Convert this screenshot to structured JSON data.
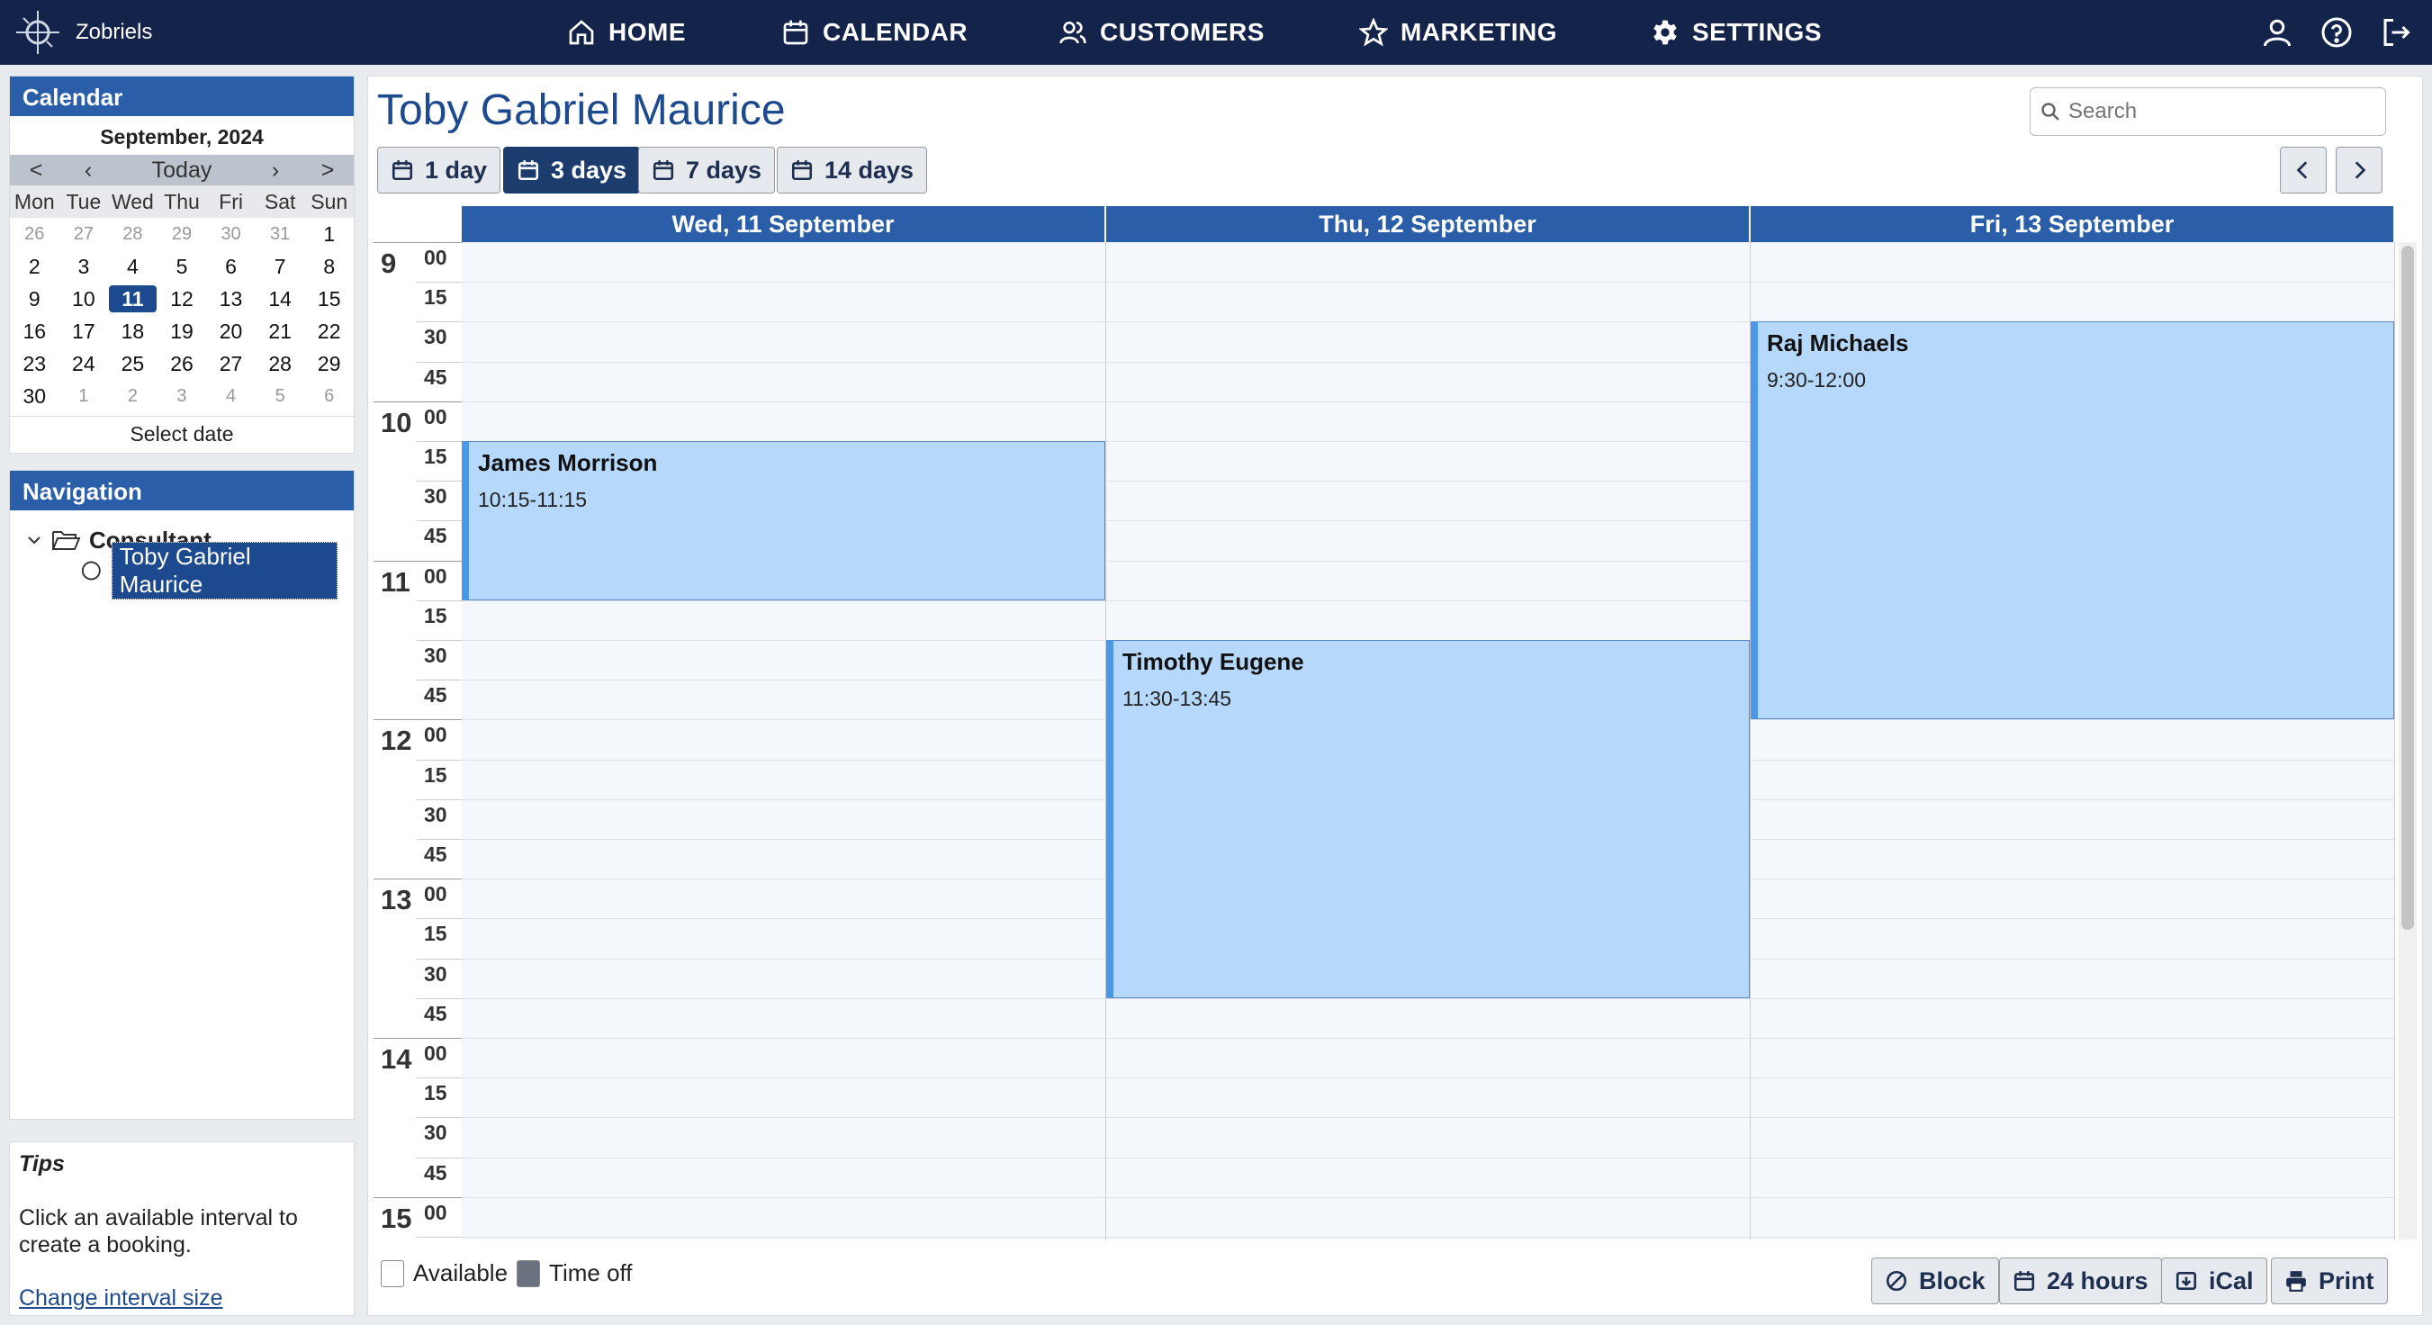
{
  "app": {
    "name": "Zobriels"
  },
  "nav": {
    "home": "HOME",
    "calendar": "CALENDAR",
    "customers": "CUSTOMERS",
    "marketing": "MARKETING",
    "settings": "SETTINGS"
  },
  "colors": {
    "topbar": "#14234a",
    "accent": "#2a5ea8",
    "booking": "#b6d8fb",
    "selected": "#1d4a8f"
  },
  "mini_calendar": {
    "title": "Calendar",
    "month": "September, 2024",
    "today_label": "Today",
    "prev_month": "<",
    "prev": "‹",
    "next": "›",
    "next_month": ">",
    "weekdays": [
      "Mon",
      "Tue",
      "Wed",
      "Thu",
      "Fri",
      "Sat",
      "Sun"
    ],
    "weeks": [
      [
        [
          "26",
          true
        ],
        [
          "27",
          true
        ],
        [
          "28",
          true
        ],
        [
          "29",
          true
        ],
        [
          "30",
          true
        ],
        [
          "31",
          true
        ],
        [
          "1",
          false
        ]
      ],
      [
        [
          "2",
          false
        ],
        [
          "3",
          false
        ],
        [
          "4",
          false
        ],
        [
          "5",
          false
        ],
        [
          "6",
          false
        ],
        [
          "7",
          false
        ],
        [
          "8",
          false
        ]
      ],
      [
        [
          "9",
          false
        ],
        [
          "10",
          false
        ],
        [
          "11",
          false
        ],
        [
          "12",
          false
        ],
        [
          "13",
          false
        ],
        [
          "14",
          false
        ],
        [
          "15",
          false
        ]
      ],
      [
        [
          "16",
          false
        ],
        [
          "17",
          false
        ],
        [
          "18",
          false
        ],
        [
          "19",
          false
        ],
        [
          "20",
          false
        ],
        [
          "21",
          false
        ],
        [
          "22",
          false
        ]
      ],
      [
        [
          "23",
          false
        ],
        [
          "24",
          false
        ],
        [
          "25",
          false
        ],
        [
          "26",
          false
        ],
        [
          "27",
          false
        ],
        [
          "28",
          false
        ],
        [
          "29",
          false
        ]
      ],
      [
        [
          "30",
          false
        ],
        [
          "1",
          true
        ],
        [
          "2",
          true
        ],
        [
          "3",
          true
        ],
        [
          "4",
          true
        ],
        [
          "5",
          true
        ],
        [
          "6",
          true
        ]
      ]
    ],
    "selected_day": "11",
    "select_date": "Select date"
  },
  "navigation": {
    "title": "Navigation",
    "group": "Consultant",
    "selected_person": "Toby Gabriel Maurice"
  },
  "tips": {
    "title": "Tips",
    "text": "Click an available interval to create a booking.",
    "link": "Change interval size"
  },
  "main": {
    "title": "Toby Gabriel Maurice",
    "search_placeholder": "Search",
    "views": [
      "1 day",
      "3 days",
      "7 days",
      "14 days"
    ],
    "active_view": "3 days",
    "days": [
      "Wed, 11 September",
      "Thu, 12 September",
      "Fri, 13 September"
    ],
    "time_labels": {
      "hours": [
        "9",
        "10",
        "11",
        "12",
        "13",
        "14",
        "15"
      ],
      "minutes": [
        "00",
        "15",
        "30",
        "45"
      ]
    },
    "bookings": [
      {
        "name": "James Morrison",
        "time": "10:15-11:15",
        "day": 0,
        "start": 10.25,
        "end": 11.25
      },
      {
        "name": "Timothy Eugene",
        "time": "11:30-13:45",
        "day": 1,
        "start": 11.5,
        "end": 13.75
      },
      {
        "name": "Raj Michaels",
        "time": "9:30-12:00",
        "day": 2,
        "start": 9.5,
        "end": 12.0
      }
    ]
  },
  "legend": {
    "available": "Available",
    "time_off": "Time off"
  },
  "actions": {
    "block": "Block",
    "hours": "24 hours",
    "ical": "iCal",
    "print": "Print"
  }
}
